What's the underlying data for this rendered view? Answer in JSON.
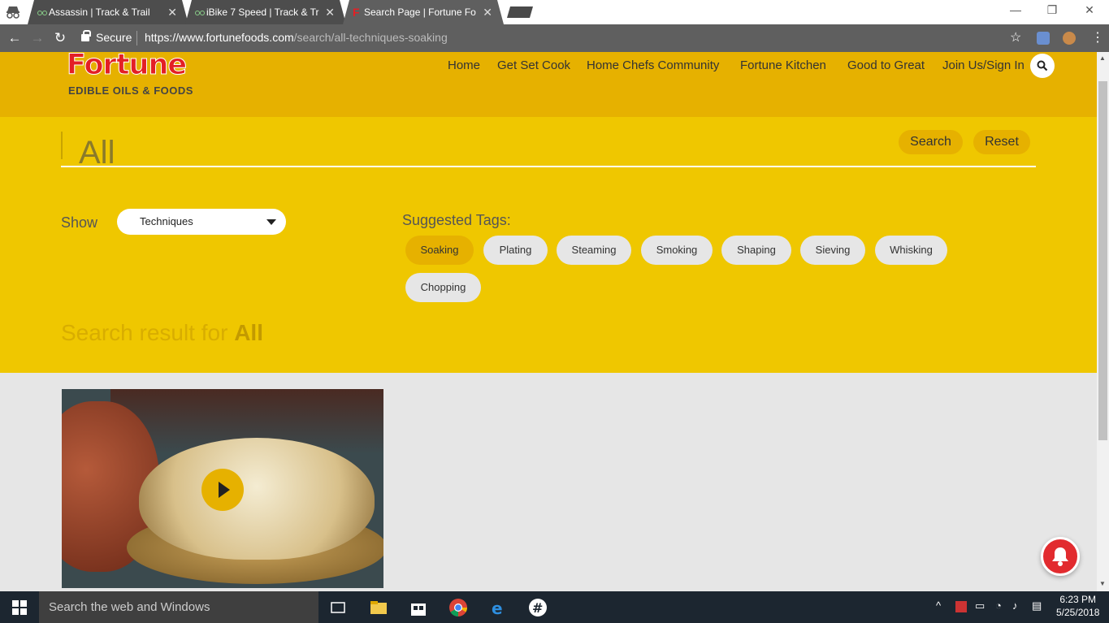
{
  "browser": {
    "tabs": [
      {
        "title": "Assassin | Track & Trail",
        "active": false
      },
      {
        "title": "iBike 7 Speed | Track & Tr",
        "active": false
      },
      {
        "title": "Search Page | Fortune Fo",
        "active": true
      }
    ],
    "secure_label": "Secure",
    "url_host": "https://www.fortunefoods.com",
    "url_path": "/search/all-techniques-soaking"
  },
  "header": {
    "logo_word": "Fortune",
    "logo_sub": "EDIBLE OILS & FOODS",
    "nav": [
      "Home",
      "Get Set Cook",
      "Home Chefs Community",
      "Fortune Kitchen",
      "Good to Great",
      "Join Us/Sign In"
    ]
  },
  "search": {
    "query": "All",
    "search_label": "Search",
    "reset_label": "Reset",
    "show_label": "Show",
    "show_value": "Techniques",
    "suggested_label": "Suggested Tags:",
    "tags": [
      "Soaking",
      "Plating",
      "Steaming",
      "Smoking",
      "Shaping",
      "Sieving",
      "Whisking",
      "Chopping"
    ],
    "active_tag": "Soaking",
    "result_prefix": "Search result for",
    "result_term": "All"
  },
  "taskbar": {
    "search_placeholder": "Search the web and Windows",
    "time": "6:23 PM",
    "date": "5/25/2018"
  },
  "colors": {
    "header": "#e6b100",
    "band": "#efc700",
    "accent": "#e32025"
  }
}
